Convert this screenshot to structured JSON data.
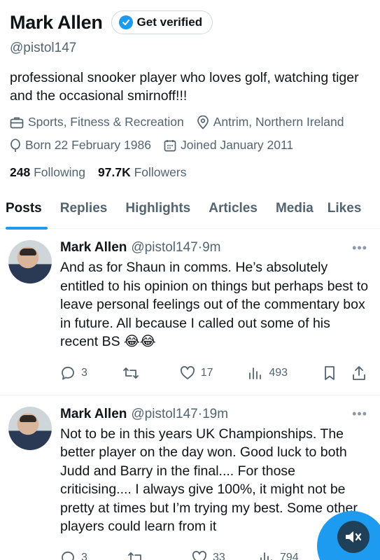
{
  "profile": {
    "name": "Mark Allen",
    "verify_label": "Get verified",
    "handle": "@pistol147",
    "bio": "professional snooker player who loves golf, watching tiger and the occasional smirnoff!!!",
    "category": "Sports, Fitness & Recreation",
    "location": "Antrim, Northern Ireland",
    "born": "Born 22 February 1986",
    "joined": "Joined January 2011",
    "following_count": "248",
    "following_label": "Following",
    "followers_count": "97.7K",
    "followers_label": "Followers"
  },
  "tabs": [
    "Posts",
    "Replies",
    "Highlights",
    "Articles",
    "Media",
    "Likes"
  ],
  "tweets": [
    {
      "name": "Mark Allen",
      "handle": "@pistol147",
      "dot": "·",
      "time": "9m",
      "text": "And as for Shaun in comms. He’s absolutely entitled to his opinion on things but perhaps best to leave personal feelings out of the commentary box in future. All because I called out some of his recent BS 😂😂",
      "replies": "3",
      "reposts": "",
      "likes": "17",
      "views": "493"
    },
    {
      "name": "Mark Allen",
      "handle": "@pistol147",
      "dot": "·",
      "time": "19m",
      "text": "Not to be in this years UK Championships. The better player on the day won. Good luck to both Judd and Barry in the final.... For those criticising.... I always give 100%, it might not be pretty at times but I’m trying my best. Some other players could learn from it",
      "replies": "3",
      "reposts": "",
      "likes": "33",
      "views": "794"
    }
  ],
  "colors": {
    "accent": "#1d9bf0",
    "muted": "#536471"
  }
}
